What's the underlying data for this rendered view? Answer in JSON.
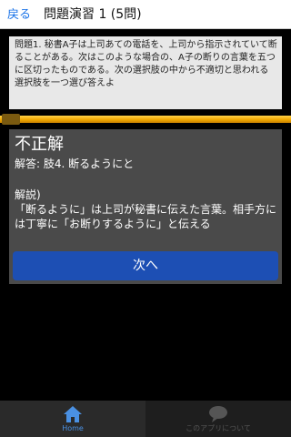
{
  "header": {
    "back_label": "戻る",
    "title": "問題演習 1 (5問)"
  },
  "question": {
    "text": "問題1. 秘書A子は上司あての電話を、上司から指示されていて断ることがある。次はこのような場合の、A子の断りの言葉を五つに区切ったものである。次の選択肢の中から不適切と思われる選択肢を一つ選び答えよ"
  },
  "progress": {
    "fraction": 1.0
  },
  "answer": {
    "result": "不正解",
    "answer_line": "解答: 肢4. 断るようにと",
    "explain_title": "解説)",
    "explain_text": "「断るように」は上司が秘書に伝えた言葉。相手方には丁寧に「お断りするように」と伝える"
  },
  "next_button": {
    "label": "次へ"
  },
  "bottom_nav": {
    "items": [
      {
        "label": "Home",
        "icon": "home-icon",
        "active": true
      },
      {
        "label": "このアプリについて",
        "icon": "speech-bubble-icon",
        "active": false
      }
    ]
  },
  "colors": {
    "accent": "#4a90e2",
    "button": "#1d4fb4",
    "progress": "#f0a800",
    "panel": "#4a4a4a"
  }
}
